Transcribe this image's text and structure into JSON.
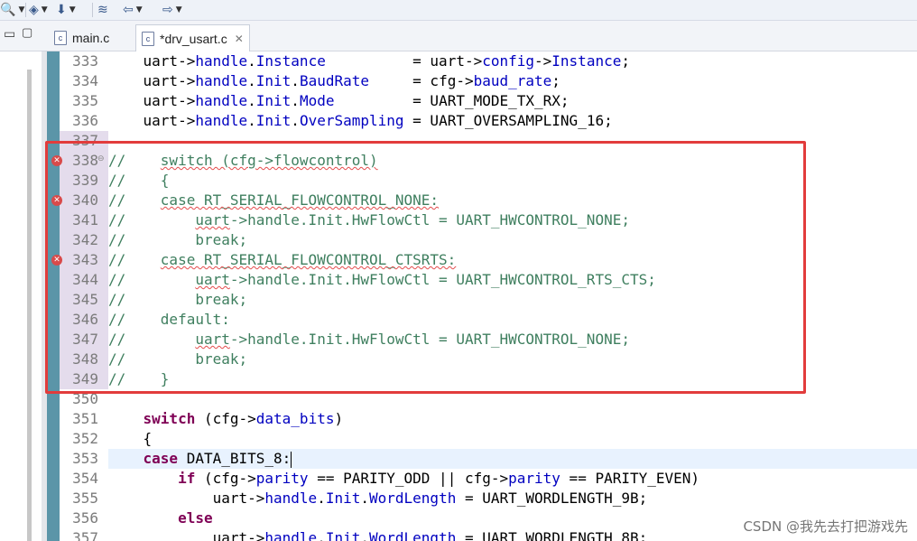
{
  "toolbar": {
    "buttons": [
      {
        "icon": "search-icon",
        "glyph": "🔍",
        "has_menu": true
      },
      {
        "icon": "build-icon",
        "glyph": "◈",
        "has_menu": true
      },
      {
        "icon": "download-icon",
        "glyph": "⬇",
        "has_menu": true
      },
      {
        "icon": "layers-icon",
        "glyph": "≋",
        "has_menu": false
      },
      {
        "icon": "back-arrow-icon",
        "glyph": "⇦",
        "has_menu": true
      },
      {
        "icon": "forward-arrow-icon",
        "glyph": "⇨",
        "has_menu": true
      }
    ]
  },
  "tabs": [
    {
      "label": "main.c",
      "active": false,
      "icon": "c-file-icon"
    },
    {
      "label": "*drv_usart.c",
      "active": true,
      "icon": "c-file-icon",
      "close": "✕"
    }
  ],
  "editor": {
    "accent_color": "#e23c3c",
    "lines": [
      {
        "n": "333",
        "text": "    uart->handle.Instance          = uart->config->Instance;"
      },
      {
        "n": "334",
        "text": "    uart->handle.Init.BaudRate     = cfg->baud_rate;"
      },
      {
        "n": "335",
        "text": "    uart->handle.Init.Mode         = UART_MODE_TX_RX;"
      },
      {
        "n": "336",
        "text": "    uart->handle.Init.OverSampling = UART_OVERSAMPLING_16;"
      },
      {
        "n": "337",
        "text": ""
      },
      {
        "n": "338",
        "text": "//    switch (cfg->flowcontrol)",
        "error": true,
        "fold": true
      },
      {
        "n": "339",
        "text": "//    {"
      },
      {
        "n": "340",
        "text": "//    case RT_SERIAL_FLOWCONTROL_NONE:",
        "error": true
      },
      {
        "n": "341",
        "text": "//        uart->handle.Init.HwFlowCtl = UART_HWCONTROL_NONE;"
      },
      {
        "n": "342",
        "text": "//        break;"
      },
      {
        "n": "343",
        "text": "//    case RT_SERIAL_FLOWCONTROL_CTSRTS:",
        "error": true
      },
      {
        "n": "344",
        "text": "//        uart->handle.Init.HwFlowCtl = UART_HWCONTROL_RTS_CTS;"
      },
      {
        "n": "345",
        "text": "//        break;"
      },
      {
        "n": "346",
        "text": "//    default:"
      },
      {
        "n": "347",
        "text": "//        uart->handle.Init.HwFlowCtl = UART_HWCONTROL_NONE;"
      },
      {
        "n": "348",
        "text": "//        break;"
      },
      {
        "n": "349",
        "text": "//    }"
      },
      {
        "n": "350",
        "text": ""
      },
      {
        "n": "351",
        "text": "    switch (cfg->data_bits)"
      },
      {
        "n": "352",
        "text": "    {"
      },
      {
        "n": "353",
        "text": "    case DATA_BITS_8:",
        "current": true
      },
      {
        "n": "354",
        "text": "        if (cfg->parity == PARITY_ODD || cfg->parity == PARITY_EVEN)"
      },
      {
        "n": "355",
        "text": "            uart->handle.Init.WordLength = UART_WORDLENGTH_9B;"
      },
      {
        "n": "356",
        "text": "        else"
      },
      {
        "n": "357",
        "text": "            uart->handle.Init.WordLength = UART_WORDLENGTH_8B;"
      }
    ]
  },
  "watermark": "CSDN @我先去打把游戏先"
}
